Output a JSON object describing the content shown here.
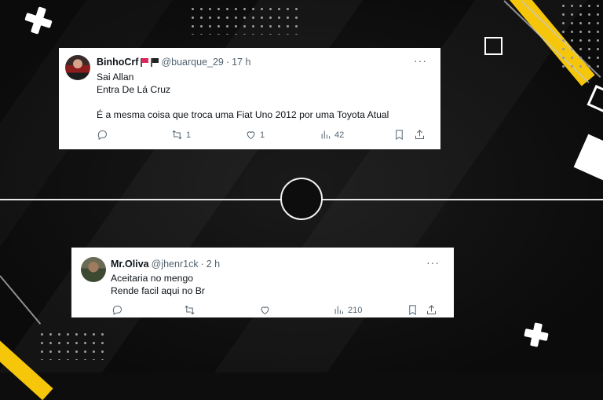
{
  "tweets": [
    {
      "display_name": "BinhoCrf",
      "handle": "@buarque_29",
      "separator": "·",
      "time": "17 h",
      "more": "···",
      "lines": [
        "Sai Allan",
        "Entra De Lá Cruz",
        "",
        "É a mesma coisa que troca uma Fiat Uno 2012 por uma Toyota Atual"
      ],
      "retweets": "1",
      "likes": "1",
      "views": "42"
    },
    {
      "display_name": "Mr.Oliva",
      "handle": "@jhenr1ck",
      "separator": "·",
      "time": "2 h",
      "more": "···",
      "lines": [
        "Aceitaria  no mengo",
        "Rende facil aqui no Br"
      ],
      "retweets": "",
      "likes": "",
      "views": "210"
    }
  ],
  "colors": {
    "accent_yellow": "#f6c60b",
    "background": "#0d0d0d",
    "text_secondary": "#536471"
  },
  "icons": [
    "reply-icon",
    "retweet-icon",
    "like-icon",
    "views-icon",
    "bookmark-icon",
    "share-icon",
    "more-icon",
    "flag-icon"
  ]
}
